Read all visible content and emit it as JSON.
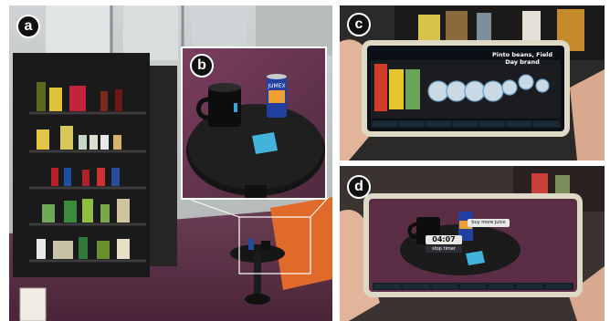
{
  "panels": {
    "a": {
      "label": "a"
    },
    "b": {
      "label": "b",
      "can_text": "JUMEX"
    },
    "c": {
      "label": "c",
      "ar_title": "Pinto beans, Field Day brand"
    },
    "d": {
      "label": "d",
      "timer_value": "04:07",
      "timer_button": "stop timer",
      "reminder_button": "buy more juice"
    }
  }
}
